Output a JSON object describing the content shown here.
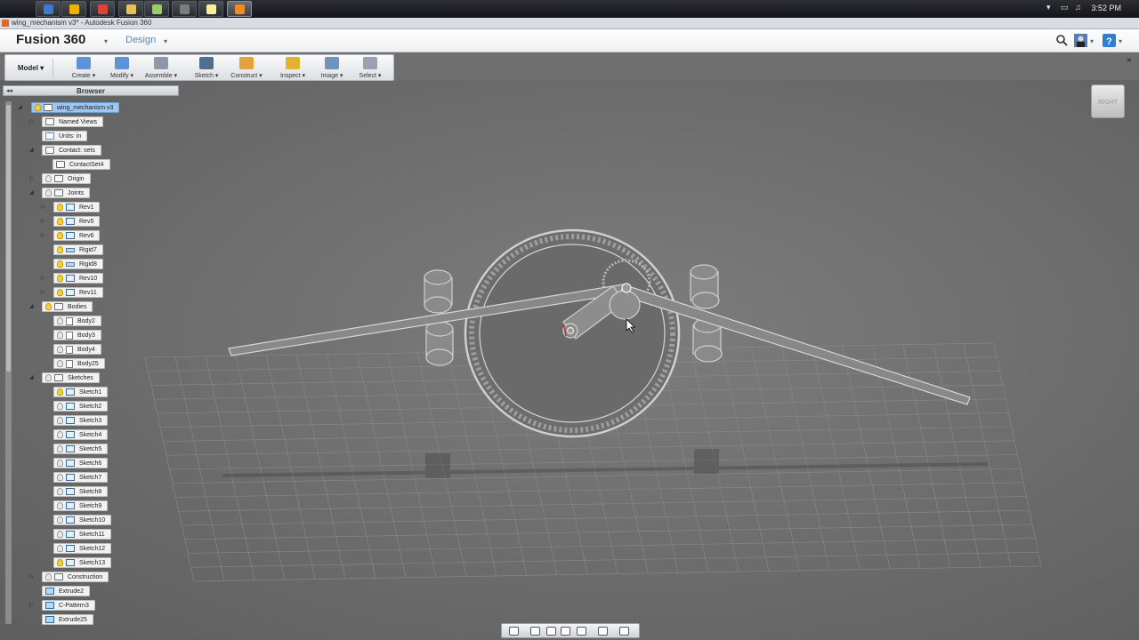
{
  "taskbar": {
    "apps": [
      {
        "icon": "outlook-icon",
        "color": "#3a7bd5",
        "active": false
      },
      {
        "icon": "notes-icon",
        "color": "#f0b400",
        "active": false
      },
      {
        "icon": "chrome-icon",
        "color": "#db4437",
        "active": false
      },
      {
        "icon": "explorer-icon",
        "color": "#e8c15b",
        "active": false
      },
      {
        "icon": "photos-icon",
        "color": "#9ccd62",
        "active": false
      },
      {
        "icon": "media-icon",
        "color": "#7c7c7c",
        "active": false
      },
      {
        "icon": "sticky-notes-icon",
        "color": "#f5f099",
        "active": false
      },
      {
        "icon": "fusion360-icon",
        "color": "#f08a24",
        "active": true
      }
    ],
    "clock": "3:52 PM"
  },
  "window": {
    "title": "wing_mechanism v3* - Autodesk Fusion 360"
  },
  "app": {
    "name": "Fusion 360",
    "workspace": "Design"
  },
  "toolbar": {
    "model": "Model ▾",
    "tools": [
      {
        "label": "Create ▾",
        "icon": "create-icon",
        "color": "#5d93d8"
      },
      {
        "label": "Modify ▾",
        "icon": "modify-icon",
        "color": "#5d93d8"
      },
      {
        "label": "Assemble ▾",
        "icon": "assemble-icon",
        "color": "#8f99a6"
      },
      {
        "label": "Sketch ▾",
        "icon": "sketch-icon",
        "color": "#4f6f8f"
      },
      {
        "label": "Construct ▾",
        "icon": "construct-icon",
        "color": "#e3a23a"
      },
      {
        "label": "Inspect ▾",
        "icon": "inspect-icon",
        "color": "#e0b52e"
      },
      {
        "label": "Image ▾",
        "icon": "image-icon",
        "color": "#6f94b8"
      },
      {
        "label": "Select ▾",
        "icon": "select-icon",
        "color": "#9aa3ad"
      }
    ],
    "close": "×"
  },
  "browser": {
    "title": "Browser",
    "collapse": "◂◂",
    "nodes": [
      {
        "label": "wing_mechanism v3",
        "type": "folder",
        "bulb": "on",
        "tri": "◢",
        "selected": true
      },
      {
        "label": "Named Views",
        "type": "folder",
        "bulb": "none",
        "tri": "▷"
      },
      {
        "label": "Units: in",
        "type": "units",
        "bulb": "none",
        "tri": ""
      },
      {
        "label": "Contact: sets",
        "type": "folder",
        "bulb": "none",
        "tri": "◢"
      },
      {
        "label": "ContactSet4",
        "type": "folder",
        "bulb": "none",
        "tri": ""
      },
      {
        "label": "Origin",
        "type": "folder",
        "bulb": "off",
        "tri": "▷"
      },
      {
        "label": "Joints",
        "type": "folder",
        "bulb": "off",
        "tri": "◢"
      },
      {
        "label": "Rev1",
        "type": "joint",
        "bulb": "on",
        "tri": "▷"
      },
      {
        "label": "Rev5",
        "type": "joint",
        "bulb": "on",
        "tri": "▷"
      },
      {
        "label": "Rev6",
        "type": "joint",
        "bulb": "on",
        "tri": "▷"
      },
      {
        "label": "Rigid7",
        "type": "rigid",
        "bulb": "on",
        "tri": ""
      },
      {
        "label": "Rigid8",
        "type": "rigid",
        "bulb": "on",
        "tri": ""
      },
      {
        "label": "Rev10",
        "type": "joint",
        "bulb": "on",
        "tri": "▷"
      },
      {
        "label": "Rev11",
        "type": "joint",
        "bulb": "on",
        "tri": "▷"
      },
      {
        "label": "Bodies",
        "type": "folder",
        "bulb": "on",
        "tri": "◢"
      },
      {
        "label": "Body2",
        "type": "body",
        "bulb": "off",
        "tri": ""
      },
      {
        "label": "Body3",
        "type": "body",
        "bulb": "off",
        "tri": ""
      },
      {
        "label": "Body4",
        "type": "body",
        "bulb": "off",
        "tri": ""
      },
      {
        "label": "Body25",
        "type": "body",
        "bulb": "off",
        "tri": ""
      },
      {
        "label": "Sketches",
        "type": "folder",
        "bulb": "off",
        "tri": "◢"
      },
      {
        "label": "Sketch1",
        "type": "sketch",
        "bulb": "on",
        "tri": ""
      },
      {
        "label": "Sketch2",
        "type": "sketch",
        "bulb": "off",
        "tri": ""
      },
      {
        "label": "Sketch3",
        "type": "sketch",
        "bulb": "off",
        "tri": ""
      },
      {
        "label": "Sketch4",
        "type": "sketch",
        "bulb": "off",
        "tri": ""
      },
      {
        "label": "Sketch5",
        "type": "sketch",
        "bulb": "off",
        "tri": ""
      },
      {
        "label": "Sketch6",
        "type": "sketch",
        "bulb": "off",
        "tri": ""
      },
      {
        "label": "Sketch7",
        "type": "sketch",
        "bulb": "off",
        "tri": ""
      },
      {
        "label": "Sketch8",
        "type": "sketch",
        "bulb": "off",
        "tri": ""
      },
      {
        "label": "Sketch9",
        "type": "sketch",
        "bulb": "off",
        "tri": ""
      },
      {
        "label": "Sketch10",
        "type": "sketch",
        "bulb": "off",
        "tri": ""
      },
      {
        "label": "Sketch11",
        "type": "sketch",
        "bulb": "off",
        "tri": ""
      },
      {
        "label": "Sketch12",
        "type": "sketch",
        "bulb": "off",
        "tri": ""
      },
      {
        "label": "Sketch13",
        "type": "sketch",
        "bulb": "on",
        "tri": ""
      },
      {
        "label": "Construction",
        "type": "folder",
        "bulb": "off",
        "tri": "▷"
      },
      {
        "label": "Extrude2",
        "type": "feature",
        "bulb": "none",
        "tri": ""
      },
      {
        "label": "C-Pattern3",
        "type": "pattern",
        "bulb": "none",
        "tri": "▷"
      },
      {
        "label": "Extrude25",
        "type": "feature",
        "bulb": "none",
        "tri": ""
      }
    ]
  },
  "viewcube": {
    "face": "RIGHT"
  },
  "navbar": {
    "tools": [
      "orbit-icon",
      "look-at-icon",
      "pan-icon",
      "zoom-icon",
      "fit-icon",
      "display-settings-icon",
      "grid-icon"
    ]
  },
  "colors": {
    "background": "#6f6f6f",
    "accent": "#5a87b8",
    "selection": "#9fc6ee"
  }
}
